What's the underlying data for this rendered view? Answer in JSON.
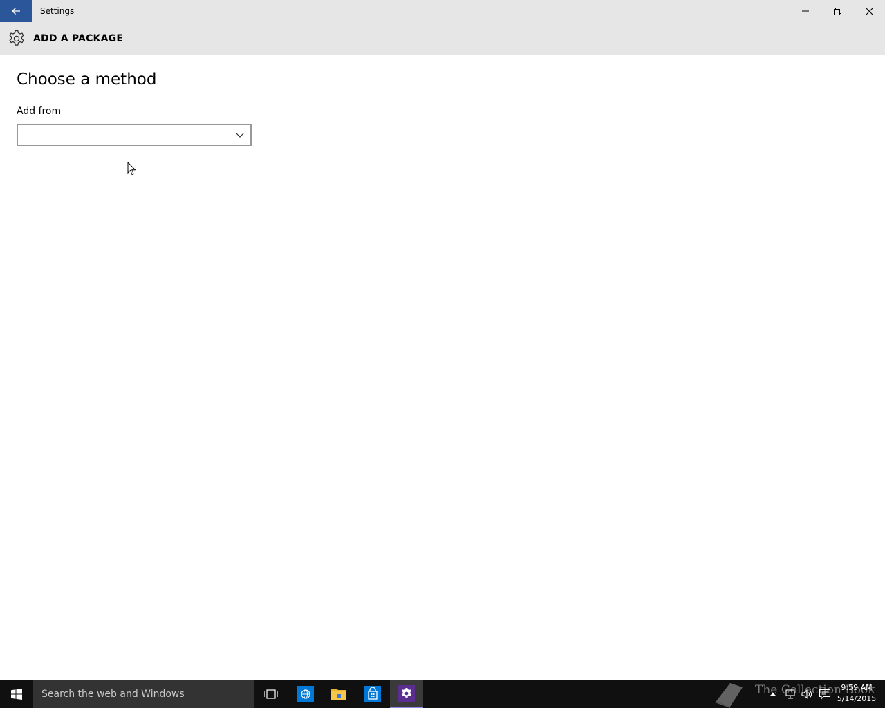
{
  "window": {
    "title": "Settings"
  },
  "header": {
    "page_title": "ADD A PACKAGE"
  },
  "main": {
    "heading": "Choose a method",
    "add_from_label": "Add from",
    "add_from_value": ""
  },
  "taskbar": {
    "search_placeholder": "Search the web and Windows",
    "watermark": "The Collection Book",
    "clock_time": "9:59 AM",
    "clock_date": "5/14/2015"
  },
  "icons": {
    "back": "back-arrow-icon",
    "minimize": "minimize-icon",
    "restore": "restore-icon",
    "close": "close-icon",
    "settings": "gear-icon",
    "dropdown": "chevron-down-icon",
    "start": "windows-logo-icon",
    "task_view": "task-view-icon",
    "browser": "browser-icon",
    "explorer": "file-explorer-icon",
    "store": "store-icon",
    "tray_chevron": "chevron-up-icon",
    "network": "network-icon",
    "volume": "volume-icon",
    "notifications": "action-center-icon"
  },
  "colors": {
    "accent": "#2b579a",
    "titlebar": "#e6e6e6",
    "taskbar": "#101010",
    "search": "#333333",
    "store_blue": "#0078d7",
    "settings_active": "#5c2d91"
  }
}
